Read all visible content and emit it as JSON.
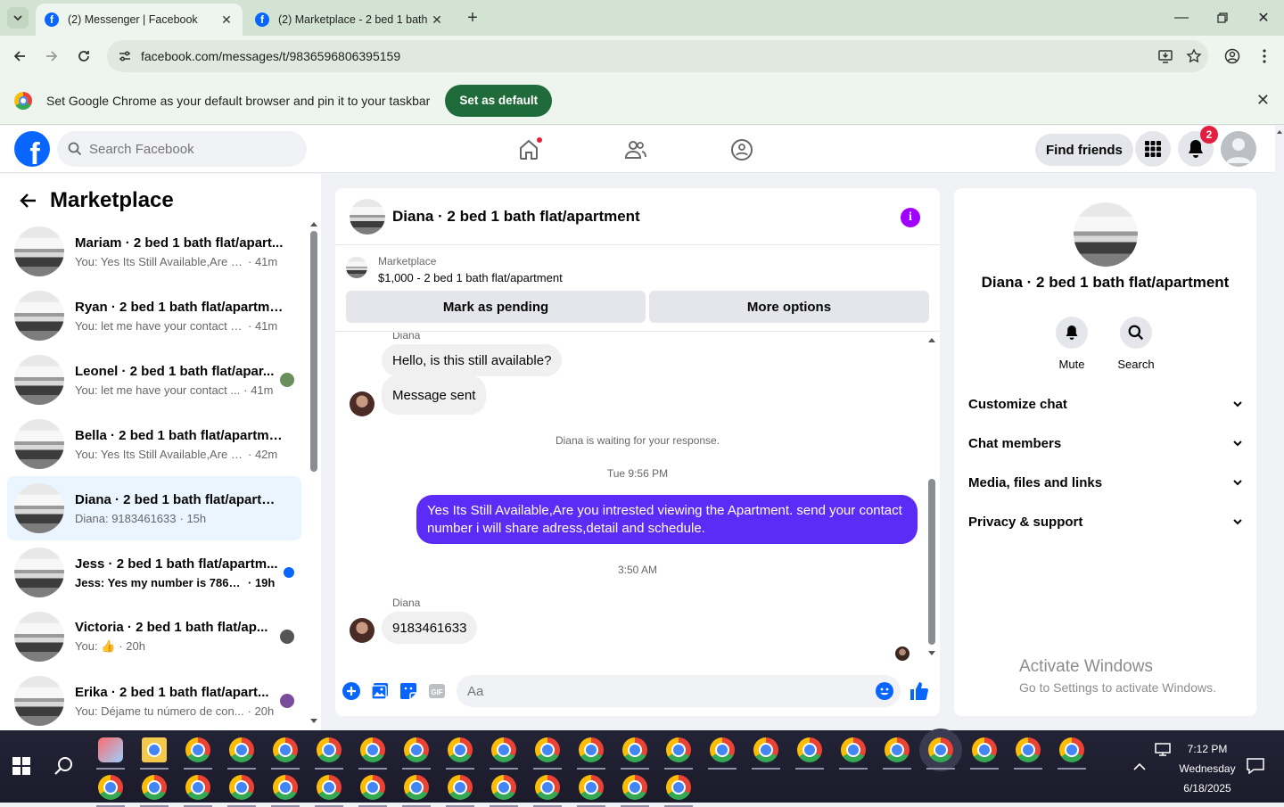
{
  "browser": {
    "tabs": [
      {
        "title": "(2) Messenger | Facebook"
      },
      {
        "title": "(2) Marketplace - 2 bed 1 bath f"
      }
    ],
    "url": "facebook.com/messages/t/9836596806395159",
    "infobar": {
      "message": "Set Google Chrome as your default browser and pin it to your taskbar",
      "button": "Set as default"
    }
  },
  "facebook": {
    "search_placeholder": "Search Facebook",
    "find_friends": "Find friends",
    "notifications_count": "2"
  },
  "left": {
    "title": "Marketplace",
    "conversations": [
      {
        "name": "Mariam · 2 bed 1 bath flat/apart...",
        "preview": "You: Yes Its Still Available,Are you ...",
        "time": "· 41m",
        "unread": false,
        "selected": false
      },
      {
        "name": "Ryan · 2 bed 1 bath flat/apartme...",
        "preview": "You: let me have your contact nu...",
        "time": "· 41m",
        "unread": false,
        "selected": false
      },
      {
        "name": "Leonel · 2 bed 1 bath flat/apar...",
        "preview": "You: let me have your contact ...",
        "time": "· 41m",
        "unread": false,
        "selected": false
      },
      {
        "name": "Bella · 2 bed 1 bath flat/apartment",
        "preview": "You: Yes Its Still Available,Are you ...",
        "time": "· 42m",
        "unread": false,
        "selected": false
      },
      {
        "name": "Diana · 2 bed 1 bath flat/apartm...",
        "preview": "Diana: 9183461633",
        "time": "· 15h",
        "unread": false,
        "selected": true
      },
      {
        "name": "Jess · 2 bed 1 bath flat/apartm...",
        "preview": "Jess: Yes my number is 786781...",
        "time": "· 19h",
        "unread": true,
        "selected": false
      },
      {
        "name": "Victoria · 2 bed 1 bath flat/ap...",
        "preview": "You: 👍",
        "time": "· 20h",
        "unread": false,
        "selected": false
      },
      {
        "name": "Erika · 2 bed 1 bath flat/apart...",
        "preview": "You: Déjame tu número de con...",
        "time": "· 20h",
        "unread": false,
        "selected": false
      }
    ]
  },
  "chat": {
    "title": "Diana · 2 bed 1 bath flat/apartment",
    "marketplace_label": "Marketplace",
    "listing": "$1,000 - 2 bed 1 bath flat/apartment",
    "mark_pending": "Mark as pending",
    "more_options": "More options",
    "sender_top": "Diana",
    "msg1": "Hello, is this still available?",
    "msg2": "Message sent",
    "waiting": "Diana is waiting for your response.",
    "time1": "Tue 9:56 PM",
    "mine": "Yes Its Still Available,Are you intrested viewing the Apartment. send your contact number i will share adress,detail and schedule.",
    "time2": "3:50 AM",
    "sender_bottom": "Diana",
    "msg3": "9183461633",
    "composer_placeholder": "Aa"
  },
  "right": {
    "name": "Diana · 2 bed 1 bath flat/apartment",
    "mute": "Mute",
    "search": "Search",
    "sections": [
      "Customize chat",
      "Chat members",
      "Media, files and links",
      "Privacy & support"
    ]
  },
  "watermark": {
    "line1": "Activate Windows",
    "line2": "Go to Settings to activate Windows."
  },
  "taskbar": {
    "time": "7:12 PM",
    "day": "Wednesday",
    "date": "6/18/2025"
  }
}
